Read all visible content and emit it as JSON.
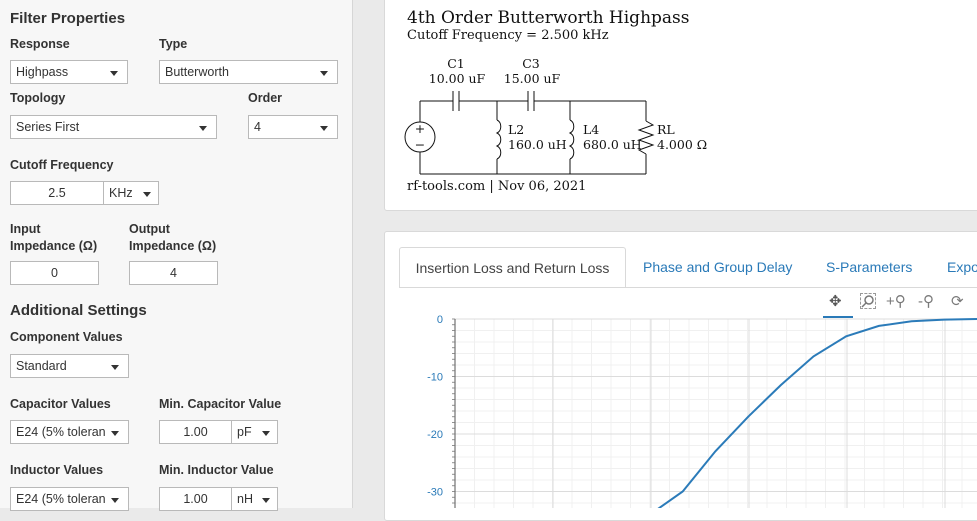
{
  "filter_properties": {
    "title": "Filter Properties",
    "response": {
      "label": "Response",
      "value": "Highpass"
    },
    "type": {
      "label": "Type",
      "value": "Butterworth"
    },
    "topology": {
      "label": "Topology",
      "value": "Series First"
    },
    "order": {
      "label": "Order",
      "value": "4"
    },
    "cutoff": {
      "label": "Cutoff Frequency",
      "value": "2.5",
      "unit": "KHz"
    },
    "input_impedance": {
      "label_line1": "Input",
      "label_line2": "Impedance (Ω)",
      "value": "0"
    },
    "output_impedance": {
      "label_line1": "Output",
      "label_line2": "Impedance (Ω)",
      "value": "4"
    }
  },
  "additional_settings": {
    "title": "Additional Settings",
    "component_values": {
      "label": "Component Values",
      "value": "Standard"
    },
    "capacitor_values": {
      "label": "Capacitor Values",
      "value": "E24 (5% toleran"
    },
    "min_capacitor": {
      "label": "Min. Capacitor Value",
      "value": "1.00",
      "unit": "pF"
    },
    "inductor_values": {
      "label": "Inductor Values",
      "value": "E24 (5% toleran"
    },
    "min_inductor": {
      "label": "Min. Inductor Value",
      "value": "1.00",
      "unit": "nH"
    }
  },
  "schematic": {
    "title": "4th Order Butterworth Highpass",
    "subtitle": "Cutoff Frequency = 2.500 kHz",
    "c1": {
      "name": "C1",
      "value": "10.00 uF"
    },
    "c3": {
      "name": "C3",
      "value": "15.00 uF"
    },
    "l2": {
      "name": "L2",
      "value": "160.0 uH"
    },
    "l4": {
      "name": "L4",
      "value": "680.0 uH"
    },
    "rl": {
      "name": "RL",
      "value": "4.000 Ω"
    },
    "source_plus": "+",
    "source_minus": "−",
    "footer": "rf-tools.com | Nov 06, 2021"
  },
  "tabs": [
    {
      "label": "Insertion Loss and Return Loss",
      "active": true
    },
    {
      "label": "Phase and Group Delay",
      "active": false
    },
    {
      "label": "S-Parameters",
      "active": false
    },
    {
      "label": "Expo",
      "active": false
    }
  ],
  "toolbar": {
    "pan_icon": "pan-icon",
    "zoom_icon": "zoom-icon",
    "zoom_in_icon": "zoom-in-icon",
    "zoom_out_icon": "zoom-out-icon",
    "reset_icon": "reset-icon"
  },
  "colors": {
    "accent": "#2a7ab8",
    "curve": "#2b7bb9"
  },
  "chart_data": {
    "type": "line",
    "title": "",
    "xlabel": "",
    "ylabel": "",
    "y_ticks": [
      "0",
      "-10",
      "-20",
      "-30"
    ],
    "ylim": [
      -33,
      0
    ],
    "grid": true,
    "series": [
      {
        "points": [
          [
            0.0,
            -34
          ],
          [
            0.1,
            -30
          ],
          [
            0.2,
            -23
          ],
          [
            0.3,
            -17
          ],
          [
            0.4,
            -11.5
          ],
          [
            0.5,
            -6.5
          ],
          [
            0.6,
            -3
          ],
          [
            0.7,
            -1.2
          ],
          [
            0.8,
            -0.4
          ],
          [
            0.9,
            -0.1
          ],
          [
            1.0,
            0
          ]
        ]
      }
    ]
  }
}
